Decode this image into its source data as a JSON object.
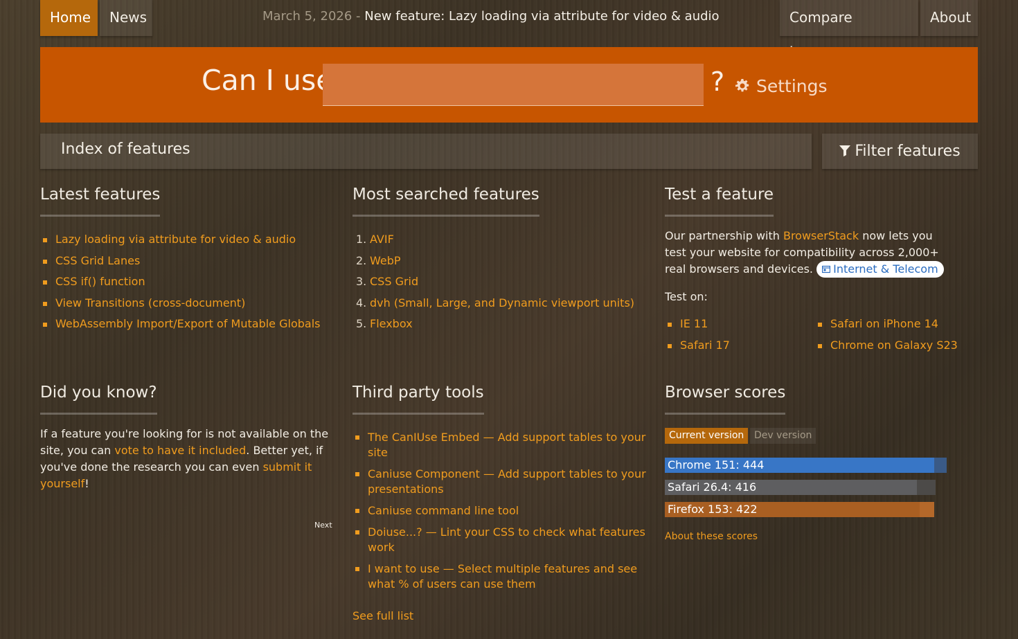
{
  "nav": {
    "home": "Home",
    "news": "News",
    "compare": "Compare browsers",
    "about": "About",
    "news_date": "March 5, 2026 -",
    "news_title": "New feature: Lazy loading via attribute for video & audio"
  },
  "search": {
    "prefix": "Can I use",
    "value": "",
    "suffix": "?",
    "settings_label": "Settings"
  },
  "index": {
    "title": "Index of features",
    "filter_label": "Filter features"
  },
  "latest": {
    "title": "Latest features",
    "items": [
      "Lazy loading via attribute for video & audio",
      "CSS Grid Lanes",
      "CSS if() function",
      "View Transitions (cross-document)",
      "WebAssembly Import/Export of Mutable Globals"
    ]
  },
  "most_searched": {
    "title": "Most searched features",
    "items": [
      {
        "n": "1.",
        "label": "AVIF"
      },
      {
        "n": "2.",
        "label": "WebP"
      },
      {
        "n": "3.",
        "label": "CSS Grid"
      },
      {
        "n": "4.",
        "label": "dvh (Small, Large, and Dynamic viewport units)"
      },
      {
        "n": "5.",
        "label": "Flexbox"
      }
    ]
  },
  "test": {
    "title": "Test a feature",
    "text_before": "Our partnership with ",
    "partner": "BrowserStack",
    "text_after": " now lets you test your website for compatibility across 2,000+ real browsers and devices.",
    "badge": "Internet & Telecom",
    "test_on": "Test on:",
    "targets_left": [
      "IE 11",
      "Safari 17"
    ],
    "targets_right": [
      "Safari on iPhone 14",
      "Chrome on Galaxy S23"
    ]
  },
  "did_you_know": {
    "title": "Did you know?",
    "t1": "If a feature you're looking for is not available on the site, you can ",
    "link1": "vote to have it included",
    "t2": ". Better yet, if you've done the research you can even ",
    "link2": "submit it yourself",
    "t3": "!",
    "next": "Next"
  },
  "third_party": {
    "title": "Third party tools",
    "items": [
      "The CanIUse Embed — Add support tables to your site",
      "Caniuse Component — Add support tables to your presentations",
      "Caniuse command line tool",
      "Doiuse...? — Lint your CSS to check what features work",
      "I want to use — Select multiple features and see what % of users can use them"
    ],
    "see_full": "See full list"
  },
  "scores": {
    "title": "Browser scores",
    "tab_current": "Current version",
    "tab_dev": "Dev version",
    "bars": [
      {
        "label": "Chrome 151: 444",
        "value": 444,
        "track": "#3a5a86",
        "fill": "#3876c6"
      },
      {
        "label": "Safari 26.4: 416",
        "value": 416,
        "track": "#4c4a48",
        "fill": "#5e5e60"
      },
      {
        "label": "Firefox 153: 422",
        "value": 422,
        "track": "#b4682a",
        "fill": "#a95f22"
      }
    ],
    "about_link": "About these scores"
  },
  "colors": {
    "accent": "#c75500",
    "link": "#f09c1e",
    "active_nav": "#b5680c"
  }
}
